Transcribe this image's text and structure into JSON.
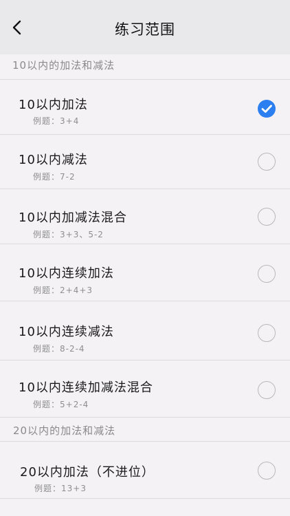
{
  "navbar": {
    "title": "练习范围",
    "back_icon": "chevron-left-icon"
  },
  "accent_color": "#2c7ff0",
  "sections": [
    {
      "header": "10以内的加法和减法",
      "items": [
        {
          "title": "10以内加法",
          "example": "例题：3+4",
          "selected": true
        },
        {
          "title": "10以内减法",
          "example": "例题：7-2",
          "selected": false
        },
        {
          "title": "10以内加减法混合",
          "example": "例题：3+3、5-2",
          "selected": false
        },
        {
          "title": "10以内连续加法",
          "example": "例题：2+4+3",
          "selected": false
        },
        {
          "title": "10以内连续减法",
          "example": "例题：8-2-4",
          "selected": false
        },
        {
          "title": "10以内连续加减法混合",
          "example": "例题：5+2-4",
          "selected": false
        }
      ]
    },
    {
      "header": "20以内的加法和减法",
      "items": [
        {
          "title": "20以内加法（不进位）",
          "example": "例题：13+3",
          "selected": false
        }
      ]
    }
  ]
}
